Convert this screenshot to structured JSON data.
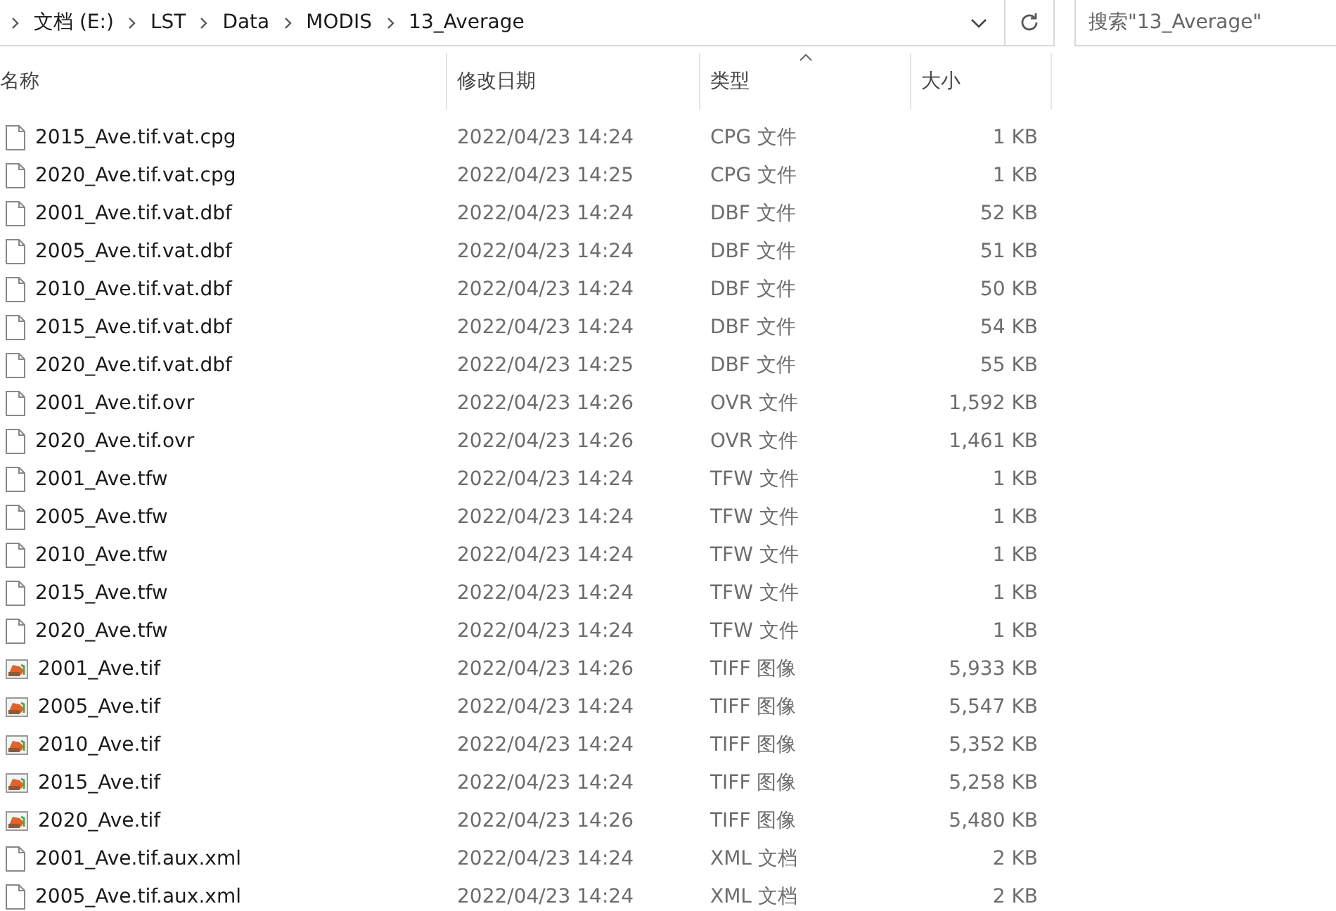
{
  "address_bar": {
    "path": [
      "文档 (E:)",
      "LST",
      "Data",
      "MODIS",
      "13_Average"
    ]
  },
  "search": {
    "placeholder": "搜索\"13_Average\""
  },
  "columns": [
    {
      "label": "名称",
      "sorted": false
    },
    {
      "label": "修改日期",
      "sorted": false
    },
    {
      "label": "类型",
      "sorted": true
    },
    {
      "label": "大小",
      "sorted": false
    }
  ],
  "rows": [
    {
      "kind": "file",
      "name": "2015_Ave.tif.vat.cpg",
      "date": "2022/04/23 14:24",
      "type": "CPG 文件",
      "size": "1 KB"
    },
    {
      "kind": "file",
      "name": "2020_Ave.tif.vat.cpg",
      "date": "2022/04/23 14:25",
      "type": "CPG 文件",
      "size": "1 KB"
    },
    {
      "kind": "file",
      "name": "2001_Ave.tif.vat.dbf",
      "date": "2022/04/23 14:24",
      "type": "DBF 文件",
      "size": "52 KB"
    },
    {
      "kind": "file",
      "name": "2005_Ave.tif.vat.dbf",
      "date": "2022/04/23 14:24",
      "type": "DBF 文件",
      "size": "51 KB"
    },
    {
      "kind": "file",
      "name": "2010_Ave.tif.vat.dbf",
      "date": "2022/04/23 14:24",
      "type": "DBF 文件",
      "size": "50 KB"
    },
    {
      "kind": "file",
      "name": "2015_Ave.tif.vat.dbf",
      "date": "2022/04/23 14:24",
      "type": "DBF 文件",
      "size": "54 KB"
    },
    {
      "kind": "file",
      "name": "2020_Ave.tif.vat.dbf",
      "date": "2022/04/23 14:25",
      "type": "DBF 文件",
      "size": "55 KB"
    },
    {
      "kind": "file",
      "name": "2001_Ave.tif.ovr",
      "date": "2022/04/23 14:26",
      "type": "OVR 文件",
      "size": "1,592 KB"
    },
    {
      "kind": "file",
      "name": "2020_Ave.tif.ovr",
      "date": "2022/04/23 14:26",
      "type": "OVR 文件",
      "size": "1,461 KB"
    },
    {
      "kind": "file",
      "name": "2001_Ave.tfw",
      "date": "2022/04/23 14:24",
      "type": "TFW 文件",
      "size": "1 KB"
    },
    {
      "kind": "file",
      "name": "2005_Ave.tfw",
      "date": "2022/04/23 14:24",
      "type": "TFW 文件",
      "size": "1 KB"
    },
    {
      "kind": "file",
      "name": "2010_Ave.tfw",
      "date": "2022/04/23 14:24",
      "type": "TFW 文件",
      "size": "1 KB"
    },
    {
      "kind": "file",
      "name": "2015_Ave.tfw",
      "date": "2022/04/23 14:24",
      "type": "TFW 文件",
      "size": "1 KB"
    },
    {
      "kind": "file",
      "name": "2020_Ave.tfw",
      "date": "2022/04/23 14:24",
      "type": "TFW 文件",
      "size": "1 KB"
    },
    {
      "kind": "image",
      "name": "2001_Ave.tif",
      "date": "2022/04/23 14:26",
      "type": "TIFF 图像",
      "size": "5,933 KB"
    },
    {
      "kind": "image",
      "name": "2005_Ave.tif",
      "date": "2022/04/23 14:24",
      "type": "TIFF 图像",
      "size": "5,547 KB"
    },
    {
      "kind": "image",
      "name": "2010_Ave.tif",
      "date": "2022/04/23 14:24",
      "type": "TIFF 图像",
      "size": "5,352 KB"
    },
    {
      "kind": "image",
      "name": "2015_Ave.tif",
      "date": "2022/04/23 14:24",
      "type": "TIFF 图像",
      "size": "5,258 KB"
    },
    {
      "kind": "image",
      "name": "2020_Ave.tif",
      "date": "2022/04/23 14:26",
      "type": "TIFF 图像",
      "size": "5,480 KB"
    },
    {
      "kind": "file",
      "name": "2001_Ave.tif.aux.xml",
      "date": "2022/04/23 14:24",
      "type": "XML 文档",
      "size": "2 KB"
    },
    {
      "kind": "file",
      "name": "2005_Ave.tif.aux.xml",
      "date": "2022/04/23 14:24",
      "type": "XML 文档",
      "size": "2 KB"
    }
  ]
}
